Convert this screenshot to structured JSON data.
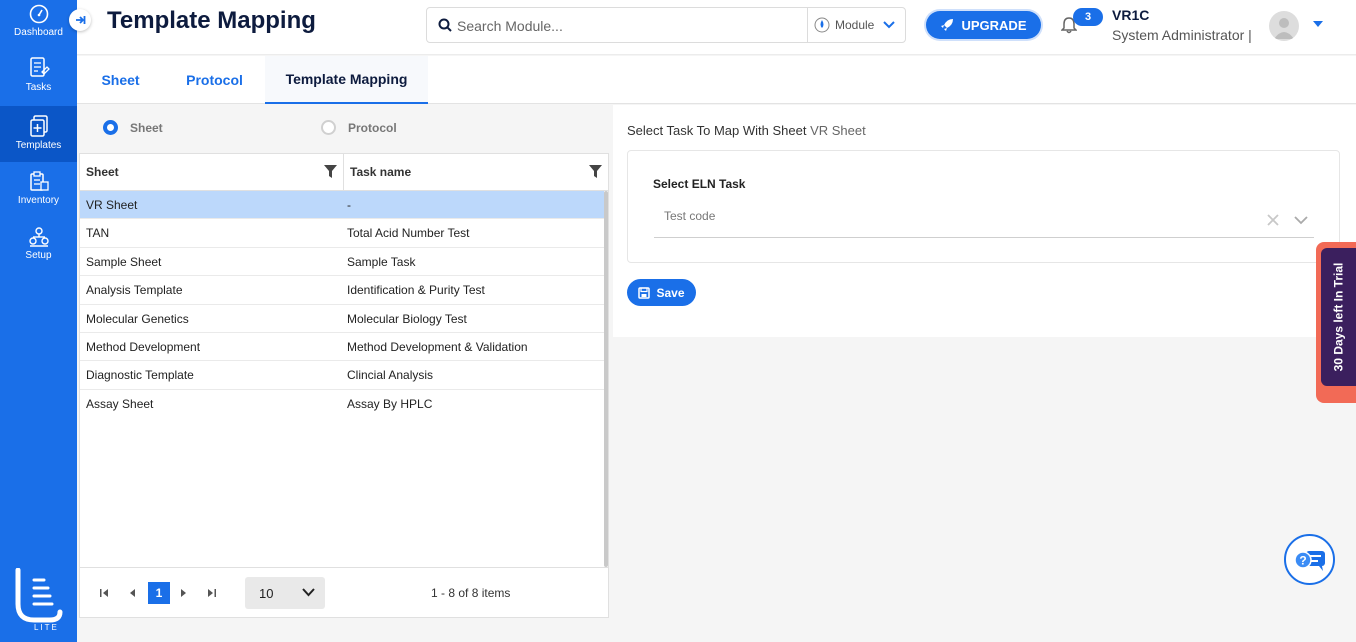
{
  "sidebar": {
    "items": [
      {
        "label": "Dashboard",
        "icon": "gauge-icon"
      },
      {
        "label": "Tasks",
        "icon": "tasks-icon"
      },
      {
        "label": "Templates",
        "icon": "templates-icon",
        "active": true
      },
      {
        "label": "Inventory",
        "icon": "inventory-icon"
      },
      {
        "label": "Setup",
        "icon": "setup-icon"
      }
    ],
    "logo_text": "LITE"
  },
  "header": {
    "title": "Template Mapping",
    "search_placeholder": "Search Module...",
    "module_label": "Module",
    "upgrade_label": "UPGRADE",
    "notification_count": "3",
    "user_name": "VR1C",
    "user_role": "System Administrator |"
  },
  "tabs": [
    {
      "label": "Sheet"
    },
    {
      "label": "Protocol"
    },
    {
      "label": "Template Mapping",
      "active": true
    }
  ],
  "radios": {
    "sheet": "Sheet",
    "protocol": "Protocol",
    "selected": "Sheet"
  },
  "grid": {
    "columns": [
      "Sheet",
      "Task name"
    ],
    "rows": [
      {
        "sheet": "VR Sheet",
        "task": "-",
        "selected": true
      },
      {
        "sheet": "TAN",
        "task": "Total Acid Number Test"
      },
      {
        "sheet": "Sample Sheet",
        "task": "Sample Task"
      },
      {
        "sheet": "Analysis Template",
        "task": "Identification & Purity Test"
      },
      {
        "sheet": "Molecular Genetics",
        "task": "Molecular Biology Test"
      },
      {
        "sheet": "Method Development",
        "task": "Method Development & Validation"
      },
      {
        "sheet": "Diagnostic Template",
        "task": "Clincial Analysis"
      },
      {
        "sheet": "Assay Sheet",
        "task": "Assay By HPLC"
      }
    ],
    "pager": {
      "current_page": "1",
      "page_size": "10",
      "info": "1 - 8 of 8 items"
    }
  },
  "mapping": {
    "title_prefix": "Select Task To Map With Sheet",
    "title_sheet": "VR Sheet",
    "task_label": "Select ELN Task",
    "task_placeholder": "Test code",
    "save_label": "Save"
  },
  "trial": {
    "text": "30 Days left In Trial"
  },
  "colors": {
    "primary": "#1a6fe8",
    "sidebar": "#1a6fe8",
    "trial_bg": "#3b1f5e",
    "trial_accent": "#f26a56",
    "selected_row": "#bcd8fb"
  }
}
